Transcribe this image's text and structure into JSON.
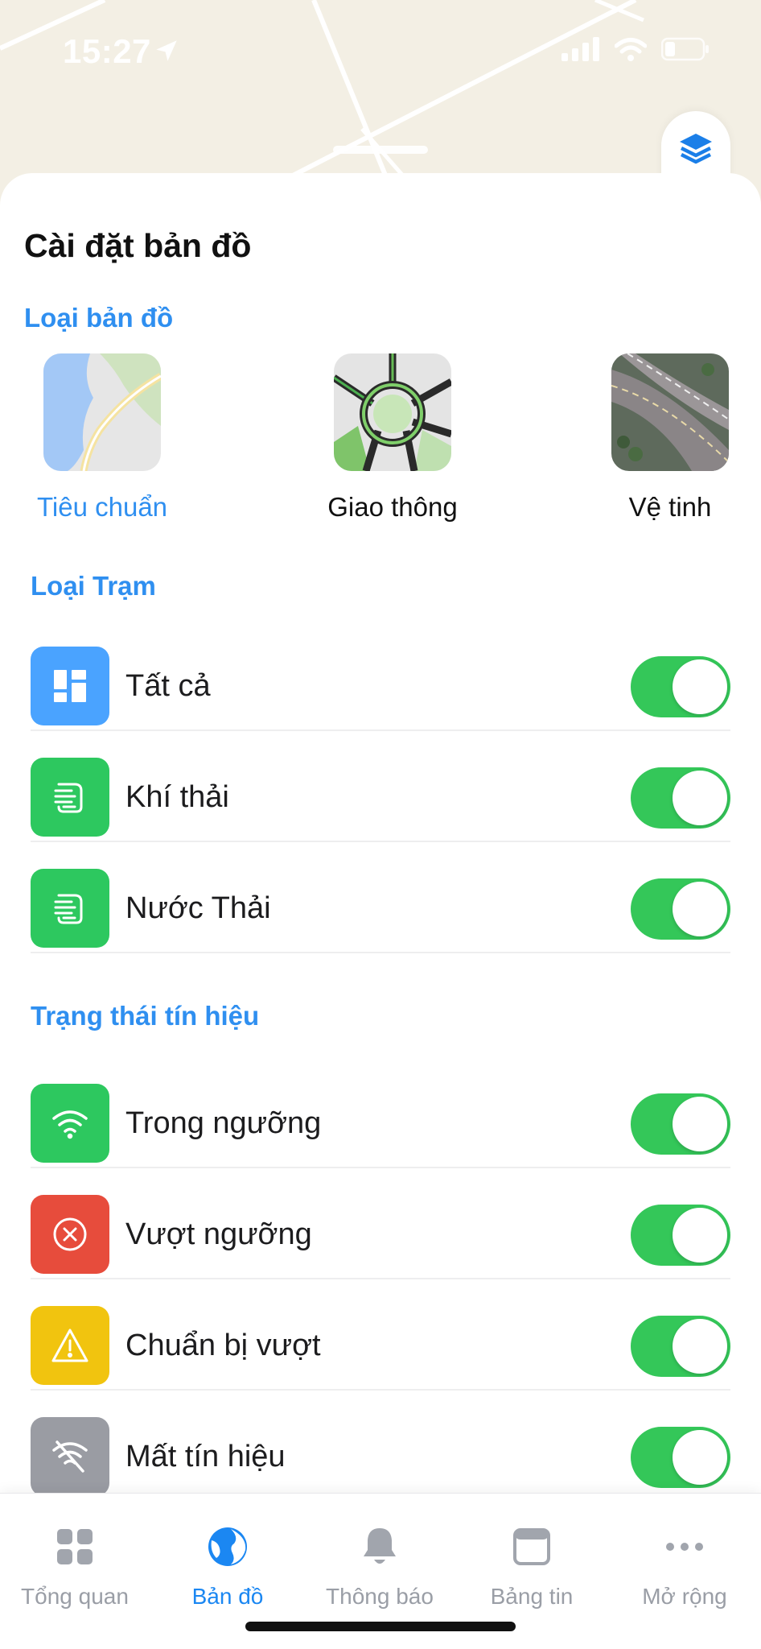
{
  "status_bar": {
    "time": "15:27"
  },
  "sheet": {
    "title": "Cài đặt bản đồ"
  },
  "map_type": {
    "section_label": "Loại bản đồ",
    "options": [
      {
        "label": "Tiêu chuẩn",
        "selected": true
      },
      {
        "label": "Giao thông",
        "selected": false
      },
      {
        "label": "Vệ tinh",
        "selected": false
      }
    ]
  },
  "station_type": {
    "section_label": "Loại Trạm",
    "items": [
      {
        "label": "Tất cả",
        "icon": "dashboard-icon",
        "color": "#4aa3ff",
        "enabled": true
      },
      {
        "label": "Khí thải",
        "icon": "emission-icon",
        "color": "#2dc85f",
        "enabled": true
      },
      {
        "label": "Nước Thải",
        "icon": "wastewater-icon",
        "color": "#2dc85f",
        "enabled": true
      }
    ]
  },
  "signal_status": {
    "section_label": "Trạng thái tín hiệu",
    "items": [
      {
        "label": "Trong ngưỡng",
        "icon": "wifi-icon",
        "color": "#2dc85f",
        "enabled": true
      },
      {
        "label": "Vượt ngưỡng",
        "icon": "close-circle-icon",
        "color": "#e74c3c",
        "enabled": true
      },
      {
        "label": "Chuẩn bị vượt",
        "icon": "warning-icon",
        "color": "#f1c40f",
        "enabled": true
      },
      {
        "label": "Mất tín hiệu",
        "icon": "wifi-off-icon",
        "color": "#9a9ca3",
        "enabled": true
      }
    ]
  },
  "tabbar": {
    "tabs": [
      {
        "label": "Tổng quan",
        "icon": "grid-icon",
        "active": false
      },
      {
        "label": "Bản đồ",
        "icon": "globe-icon",
        "active": true
      },
      {
        "label": "Thông báo",
        "icon": "bell-icon",
        "active": false
      },
      {
        "label": "Bảng tin",
        "icon": "browser-icon",
        "active": false
      },
      {
        "label": "Mở rộng",
        "icon": "more-icon",
        "active": false
      }
    ]
  },
  "colors": {
    "accent": "#2f8ff0",
    "toggle_on": "#34c759"
  }
}
